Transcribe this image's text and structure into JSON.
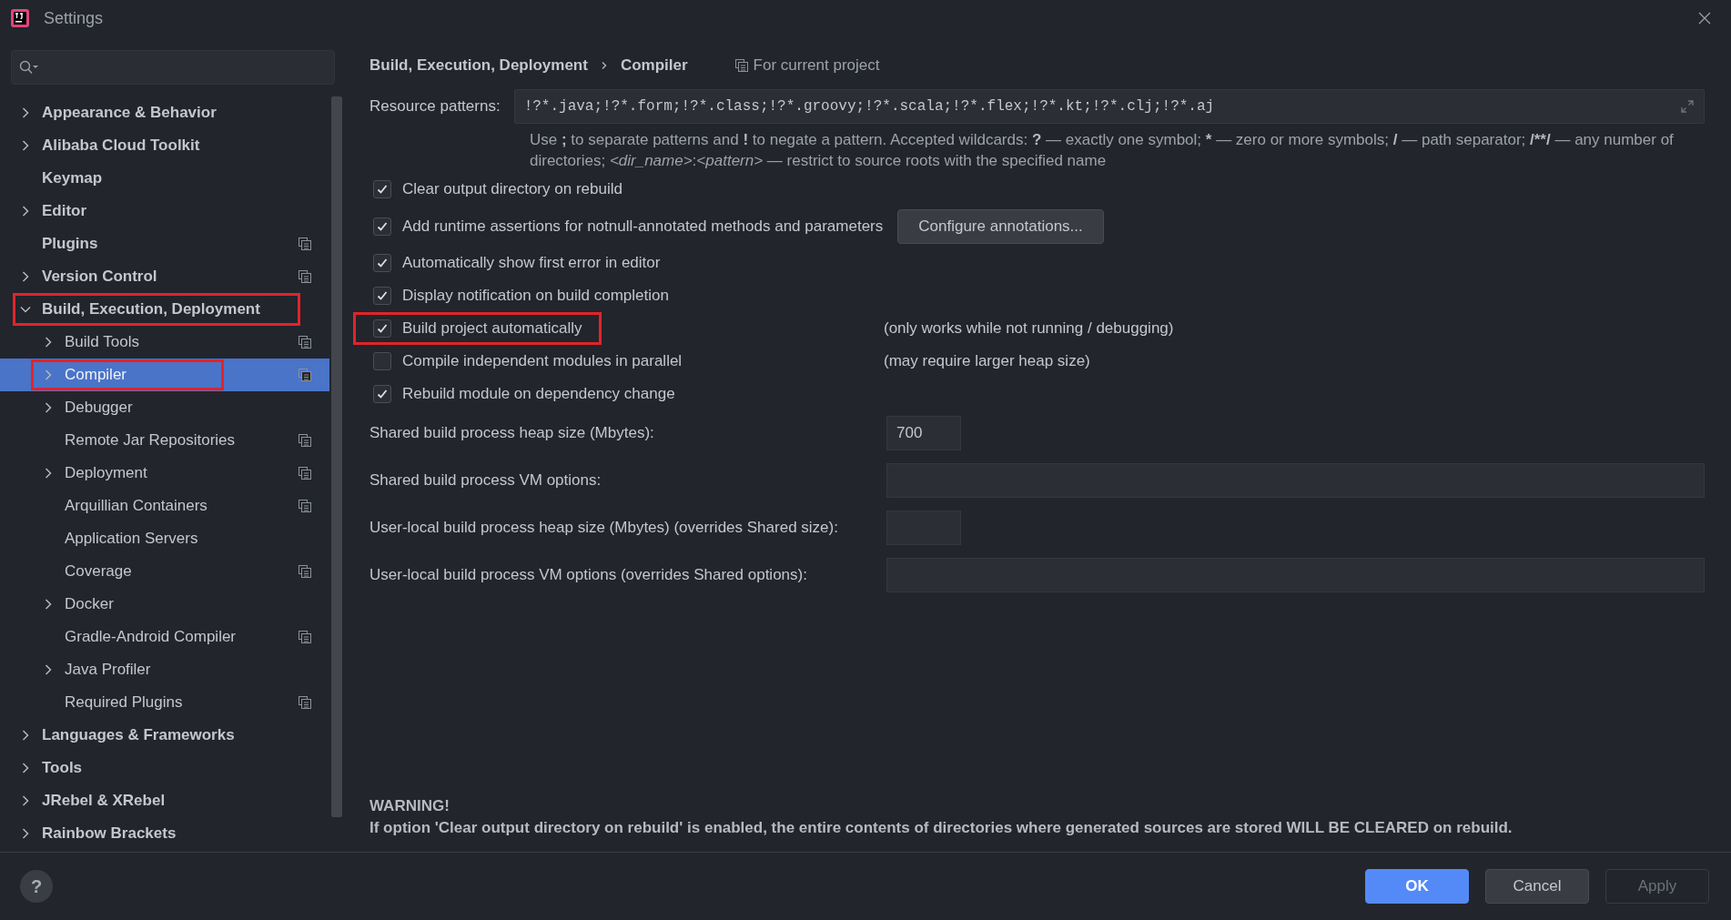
{
  "window": {
    "title": "Settings"
  },
  "sidebar": {
    "tree": [
      {
        "label": "Appearance & Behavior",
        "expanded": false,
        "selected": false,
        "project_level": false,
        "annotated": false
      },
      {
        "label": "Alibaba Cloud Toolkit",
        "expanded": false,
        "selected": false,
        "project_level": false,
        "annotated": false
      },
      {
        "label": "Keymap",
        "selected": false,
        "project_level": false,
        "annotated": false
      },
      {
        "label": "Editor",
        "expanded": false,
        "selected": false,
        "project_level": false,
        "annotated": false
      },
      {
        "label": "Plugins",
        "selected": false,
        "project_level": true,
        "annotated": false
      },
      {
        "label": "Version Control",
        "expanded": false,
        "selected": false,
        "project_level": true,
        "annotated": false
      },
      {
        "label": "Build, Execution, Deployment",
        "expanded": true,
        "selected": false,
        "project_level": false,
        "annotated": true,
        "children": [
          {
            "label": "Build Tools",
            "expanded": false,
            "selected": false,
            "project_level": true,
            "annotated": false
          },
          {
            "label": "Compiler",
            "expanded": false,
            "selected": true,
            "project_level": true,
            "annotated": true
          },
          {
            "label": "Debugger",
            "expanded": false,
            "selected": false,
            "project_level": false,
            "annotated": false
          },
          {
            "label": "Remote Jar Repositories",
            "selected": false,
            "project_level": true,
            "annotated": false
          },
          {
            "label": "Deployment",
            "expanded": false,
            "selected": false,
            "project_level": true,
            "annotated": false
          },
          {
            "label": "Arquillian Containers",
            "selected": false,
            "project_level": true,
            "annotated": false
          },
          {
            "label": "Application Servers",
            "selected": false,
            "project_level": false,
            "annotated": false
          },
          {
            "label": "Coverage",
            "selected": false,
            "project_level": true,
            "annotated": false
          },
          {
            "label": "Docker",
            "expanded": false,
            "selected": false,
            "project_level": false,
            "annotated": false
          },
          {
            "label": "Gradle-Android Compiler",
            "selected": false,
            "project_level": true,
            "annotated": false
          },
          {
            "label": "Java Profiler",
            "expanded": false,
            "selected": false,
            "project_level": false,
            "annotated": false
          },
          {
            "label": "Required Plugins",
            "selected": false,
            "project_level": true,
            "annotated": false
          }
        ]
      },
      {
        "label": "Languages & Frameworks",
        "expanded": false,
        "selected": false,
        "project_level": false,
        "annotated": false
      },
      {
        "label": "Tools",
        "expanded": false,
        "selected": false,
        "project_level": false,
        "annotated": false
      },
      {
        "label": "JRebel & XRebel",
        "expanded": false,
        "selected": false,
        "project_level": false,
        "annotated": false
      },
      {
        "label": "Rainbow Brackets",
        "expanded": false,
        "selected": false,
        "project_level": false,
        "annotated": false
      }
    ]
  },
  "breadcrumb": [
    "Build, Execution, Deployment",
    "Compiler"
  ],
  "scope": "For current project",
  "resource_patterns": {
    "label": "Resource patterns:",
    "value": "!?*.java;!?*.form;!?*.class;!?*.groovy;!?*.scala;!?*.flex;!?*.kt;!?*.clj;!?*.aj",
    "hint": [
      {
        "text": "Use ",
        "kind": "text"
      },
      {
        "text": ";",
        "kind": "symbol"
      },
      {
        "text": " to separate patterns and ",
        "kind": "text"
      },
      {
        "text": "!",
        "kind": "symbol"
      },
      {
        "text": " to negate a pattern. Accepted wildcards: ",
        "kind": "text"
      },
      {
        "text": "?",
        "kind": "symbol"
      },
      {
        "text": " — exactly one symbol; ",
        "kind": "text"
      },
      {
        "text": "*",
        "kind": "symbol"
      },
      {
        "text": " — zero or more symbols; ",
        "kind": "text"
      },
      {
        "text": "/",
        "kind": "symbol"
      },
      {
        "text": " — path separator; ",
        "kind": "text"
      },
      {
        "text": "/**/",
        "kind": "symbol"
      },
      {
        "text": " — any number of directories;  ",
        "kind": "text"
      },
      {
        "text": "<dir_name>",
        "kind": "variable"
      },
      {
        "text": ":",
        "kind": "text"
      },
      {
        "text": "<pattern>",
        "kind": "variable"
      },
      {
        "text": " — restrict to source roots with the specified name",
        "kind": "text"
      }
    ]
  },
  "options": [
    {
      "label": "Clear output directory on rebuild",
      "checked": true,
      "annotated": false
    },
    {
      "label": "Add runtime assertions for notnull-annotated methods and parameters",
      "checked": true,
      "annotated": false,
      "button": "Configure annotations..."
    },
    {
      "label": "Automatically show first error in editor",
      "checked": true,
      "annotated": false
    },
    {
      "label": "Display notification on build completion",
      "checked": true,
      "annotated": false
    },
    {
      "label": "Build project automatically",
      "checked": true,
      "annotated": true,
      "note": "(only works while not running / debugging)"
    },
    {
      "label": "Compile independent modules in parallel",
      "checked": false,
      "annotated": false,
      "note": "(may require larger heap size)"
    },
    {
      "label": "Rebuild module on dependency change",
      "checked": true,
      "annotated": false
    }
  ],
  "fields": [
    {
      "label": "Shared build process heap size (Mbytes):",
      "value": "700",
      "kind": "short"
    },
    {
      "label": "Shared build process VM options:",
      "kind": "wide"
    },
    {
      "label": "User-local build process heap size (Mbytes) (overrides Shared size):",
      "kind": "short"
    },
    {
      "label": "User-local build process VM options (overrides Shared options):",
      "kind": "wide"
    }
  ],
  "warning": {
    "title": "WARNING!",
    "text": "If option 'Clear output directory on rebuild' is enabled, the entire contents of directories where generated sources are stored WILL BE CLEARED on rebuild."
  },
  "help_button": "?",
  "buttons": [
    {
      "label": "OK",
      "kind": "primary",
      "disabled": false
    },
    {
      "label": "Cancel",
      "kind": "normal",
      "disabled": false
    },
    {
      "label": "Apply",
      "kind": "normal",
      "disabled": true
    }
  ]
}
